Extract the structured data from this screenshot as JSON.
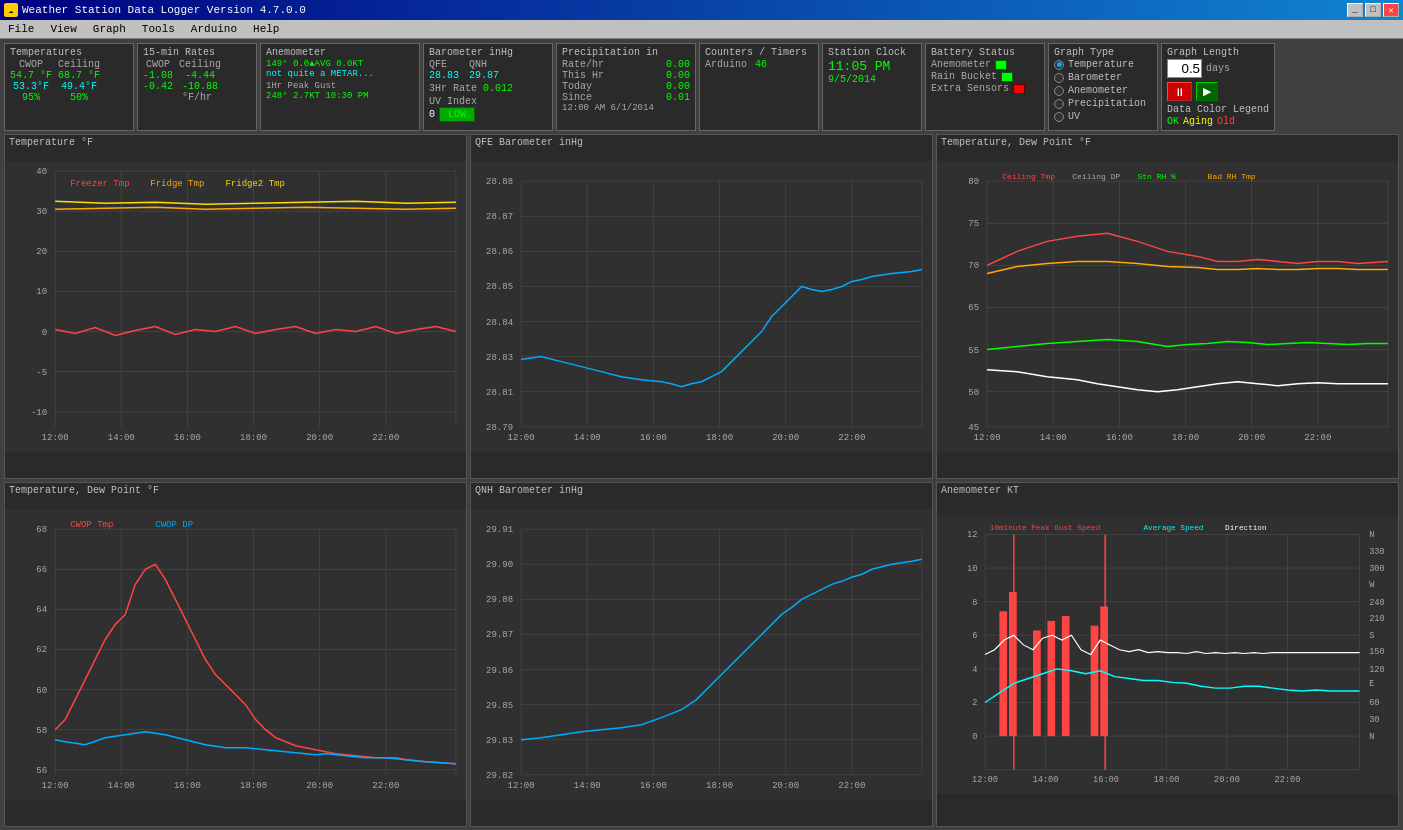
{
  "titleBar": {
    "title": "Weather Station Data Logger Version 4.7.0.0",
    "icon": "☁",
    "buttons": [
      "_",
      "□",
      "✕"
    ]
  },
  "menuBar": {
    "items": [
      "File",
      "View",
      "Graph",
      "Tools",
      "Arduino",
      "Help"
    ]
  },
  "temps": {
    "title": "Temperatures",
    "col1": "CWOP",
    "col2": "Ceiling",
    "row1_c1": "54.7 °F",
    "row1_c2": "68.7 °F",
    "row2_c1": "53.3°F",
    "row2_c2": "49.4°F",
    "row3_c1": "95%",
    "row3_c2": "50%"
  },
  "rates": {
    "title": "15-min Rates",
    "col1": "CWOP",
    "col2": "Ceiling",
    "row1_c1": "-1.08",
    "row1_c2": "-4.44",
    "row2_c1": "-0.42",
    "row2_c2": "-10.88",
    "unit": "°F/hr"
  },
  "anemometer": {
    "title": "Anemometer",
    "line1": "149° 0.0▲AVG 0.0KT",
    "line2": "not quite a METAR...",
    "peakGust": "1Hr Peak Gust",
    "peakValue": "248° 2.7KT  10:30 PM"
  },
  "barometer": {
    "title": "Barometer inHg",
    "qfe_label": "QFE",
    "qnh_label": "QNH",
    "qfe_val": "28.83",
    "qnh_val": "29.87",
    "rate_label": "3Hr Rate",
    "rate_val": "0.012",
    "uv_label": "UV Index",
    "uv_val": "0",
    "uv_status": "LOW"
  },
  "precipitation": {
    "title": "Precipitation  in",
    "rate_label": "Rate/hr",
    "rate_val": "0.00",
    "thishr_label": "This Hr",
    "thishr_val": "0.00",
    "today_label": "Today",
    "today_val": "0.00",
    "since_label": "Since",
    "since_val": "0.01",
    "since_date": "12:00 AM 6/1/2014"
  },
  "counters": {
    "title": "Counters / Timers",
    "arduino_label": "Arduino",
    "arduino_val": "46"
  },
  "stationClock": {
    "title": "Station Clock",
    "time": "11:05 PM",
    "date": "9/5/2014"
  },
  "batteryStatus": {
    "title": "Battery Status",
    "anemometer_label": "Anemometer",
    "rainBucket_label": "Rain Bucket",
    "extraSensors_label": "Extra Sensors"
  },
  "graphType": {
    "title": "Graph Type",
    "options": [
      "Temperature",
      "Barometer",
      "Anemometer",
      "Precipitation",
      "UV"
    ],
    "selected": "Temperature"
  },
  "graphLength": {
    "title": "Graph Length",
    "value": "0.5",
    "unit": "days"
  },
  "dataColorLegend": {
    "title": "Data Color Legend",
    "ok": "OK",
    "aging": "Aging",
    "old": "Old"
  },
  "charts": {
    "topLeft": {
      "title": "Temperature °F",
      "legends": [
        "Freezer Tmp",
        "Fridge Tmp",
        "Fridge2 Tmp"
      ],
      "legendColors": [
        "#ff4444",
        "#ffaa00",
        "#ffdd00"
      ],
      "xLabels": [
        "12:00",
        "14:00",
        "16:00",
        "18:00",
        "20:00",
        "22:00"
      ],
      "yMin": -10,
      "yMax": 40
    },
    "topMiddle": {
      "title": "QFE Barometer  inHg",
      "xLabels": [
        "12:00",
        "14:00",
        "16:00",
        "18:00",
        "20:00",
        "22:00"
      ],
      "yMin": 28.79,
      "yMax": 28.88
    },
    "topRight": {
      "title": "Temperature, Dew Point °F",
      "legends": [
        "Ceiling Tmp",
        "Ceiling DP",
        "Stn RH %",
        "Bad RH Tmp"
      ],
      "legendColors": [
        "#ff4444",
        "#aaaaaa",
        "#00ff00",
        "#ffaa00"
      ],
      "xLabels": [
        "12:00",
        "14:00",
        "16:00",
        "18:00",
        "20:00",
        "22:00"
      ],
      "yMin": 45,
      "yMax": 80
    },
    "bottomLeft": {
      "title": "Temperature, Dew Point °F",
      "legends": [
        "CWOP Tmp",
        "CWOP DP"
      ],
      "legendColors": [
        "#ff4444",
        "#00aaff"
      ],
      "xLabels": [
        "12:00",
        "14:00",
        "16:00",
        "18:00",
        "20:00",
        "22:00"
      ],
      "yMin": 52,
      "yMax": 68
    },
    "bottomMiddle": {
      "title": "QNH Barometer  inHg",
      "xLabels": [
        "12:00",
        "14:00",
        "16:00",
        "18:00",
        "20:00",
        "22:00"
      ],
      "yMin": 29.82,
      "yMax": 29.91
    },
    "bottomRight": {
      "title": "Anemometer  KT",
      "legends": [
        "10minute Peak Gust Speed",
        "Average Speed",
        "Direction"
      ],
      "legendColors": [
        "#ff4444",
        "#00ffff",
        "#ffffff"
      ],
      "xLabels": [
        "12:00",
        "14:00",
        "16:00",
        "18:00",
        "20:00",
        "22:00"
      ],
      "yLeft": [
        0,
        2,
        4,
        6,
        8,
        10,
        12
      ],
      "yRight": [
        "N",
        "30",
        "60",
        "E",
        "120",
        "150",
        "S",
        "210",
        "240",
        "W",
        "300",
        "330",
        "N"
      ]
    }
  }
}
